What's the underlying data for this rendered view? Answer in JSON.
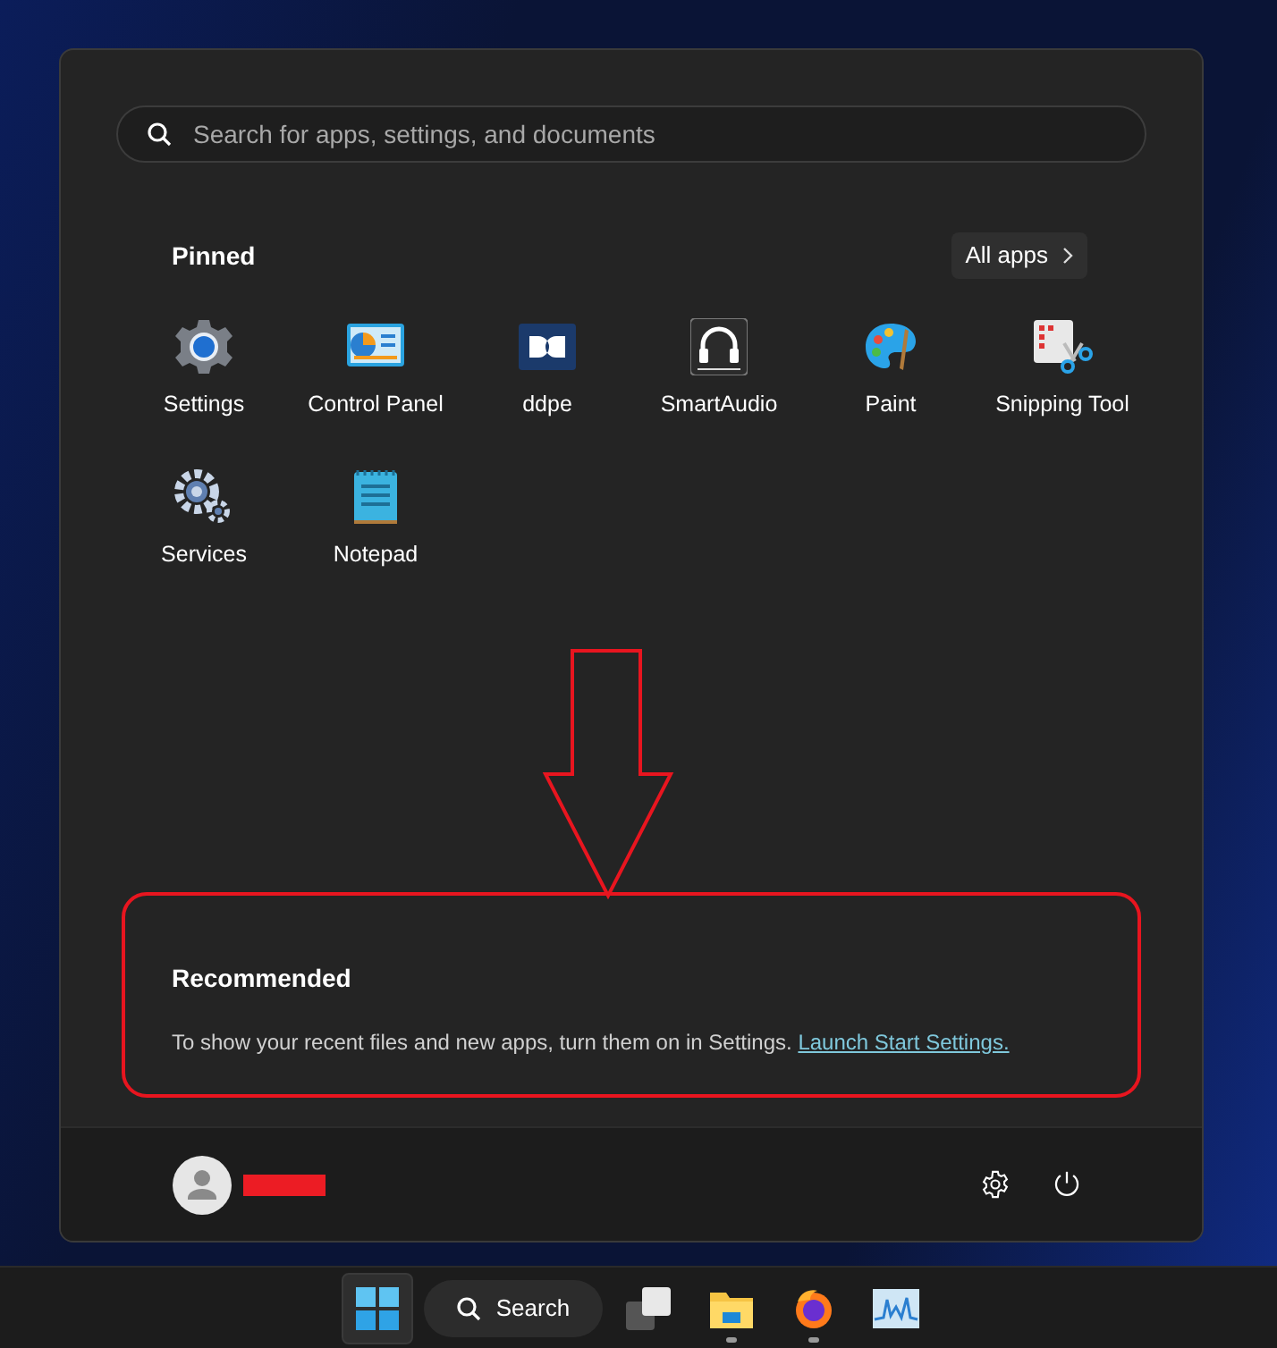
{
  "search": {
    "placeholder": "Search for apps, settings, and documents"
  },
  "pinned": {
    "title": "Pinned",
    "all_apps": "All apps",
    "apps": [
      {
        "label": "Settings",
        "kind": "settings"
      },
      {
        "label": "Control Panel",
        "kind": "control"
      },
      {
        "label": "ddpe",
        "kind": "dolby"
      },
      {
        "label": "SmartAudio",
        "kind": "audio"
      },
      {
        "label": "Paint",
        "kind": "paint"
      },
      {
        "label": "Snipping Tool",
        "kind": "snip"
      },
      {
        "label": "Services",
        "kind": "services"
      },
      {
        "label": "Notepad",
        "kind": "notepad"
      }
    ]
  },
  "recommended": {
    "title": "Recommended",
    "text": "To show your recent files and new apps, turn them on in Settings.",
    "link": "Launch Start Settings."
  },
  "taskbar": {
    "items": [
      {
        "kind": "start",
        "selected": true,
        "running": false
      },
      {
        "kind": "search",
        "label": "Search"
      },
      {
        "kind": "taskview",
        "selected": false,
        "running": false
      },
      {
        "kind": "explorer",
        "selected": false,
        "running": true
      },
      {
        "kind": "firefox",
        "selected": false,
        "running": true
      },
      {
        "kind": "monitor",
        "selected": false,
        "running": false
      }
    ]
  }
}
